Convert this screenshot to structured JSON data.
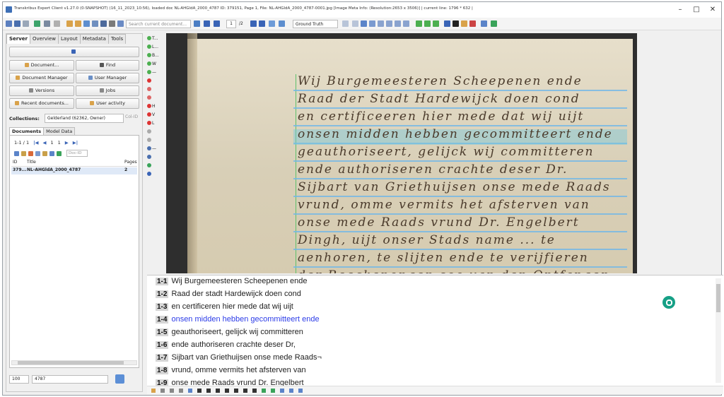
{
  "window": {
    "title": "Transkribus Expert Client v1.27.0 (0-SNAPSHOT) (16_11_2023_10:56), loaded doc NL-AHGldA_2000_4787 ID: 379151, Page 1, File: NL-AHGldA_2000_4787-0001.jpg [Image Meta Info: (Resolution:2653 x 3506)] | current line: 1796 * 632 |",
    "controls": {
      "minimize": "–",
      "maximize": "□",
      "close": "✕"
    }
  },
  "toolbar": {
    "search_placeholder": "Search current document...",
    "page_current": "1",
    "page_total": "/2",
    "view_mode": "Ground Truth"
  },
  "left_panel": {
    "tabs": [
      "Server",
      "Overview",
      "Layout",
      "Metadata",
      "Tools"
    ],
    "buttons": {
      "document": "Document...",
      "find": "Find",
      "document_manager": "Document Manager",
      "user_manager": "User Manager",
      "versions": "Versions",
      "jobs": "Jobs",
      "recent_documents": "Recent documents...",
      "user_activity": "User activity"
    },
    "collections_label": "Collections:",
    "collection_value": "Gelderland (62362, Owner)",
    "collection_id_placeholder": "Col-ID",
    "subtabs": [
      "Documents",
      "Model Data"
    ],
    "nav": {
      "range": "1-1 / 1",
      "page": "1",
      "of": "1"
    },
    "doc_id_placeholder": "Doc-ID",
    "table": {
      "headers": [
        "ID",
        "Title",
        "Pages"
      ],
      "rows": [
        {
          "id": "379...",
          "title": "NL-AHGldA_2000_4787",
          "pages": "2"
        }
      ]
    },
    "page_size": "100",
    "filter_value": "4787"
  },
  "tool_strip": [
    "T...",
    "L...",
    "B...",
    "W",
    "—",
    "",
    "",
    "",
    "H",
    "V",
    "L",
    "",
    "",
    "—",
    "",
    "",
    ""
  ],
  "handwriting": [
    "Wij Burgemeesteren Scheepenen ende",
    "Raad der Stadt Hardewijck doen cond",
    "en certificeeren hier mede dat wij uijt",
    "onsen midden hebben gecommitteert ende",
    "geauthoriseert, gelijck wij committeren",
    "ende authoriseren crachte deser Dr.",
    "Sijbart van Griethuijsen onse mede Raads",
    "vrund, omme vermits het afsterven van",
    "onse mede Raads vrund Dr. Engelbert",
    "Dingh, uijt onser Stads name ... te",
    "aenhoren, te slijten ende te verijfieren",
    "der Reeckenongen soo van den Ontfanger"
  ],
  "transcription": [
    {
      "num": "1-1",
      "text": "Wij Burgemeesteren Scheepenen ende"
    },
    {
      "num": "1-2",
      "text": "Raad der stadt Hardewijck doen cond"
    },
    {
      "num": "1-3",
      "text": "en certificeren hier mede dat wij uijt"
    },
    {
      "num": "1-4",
      "text": "onsen midden hebben gecommitteert ende",
      "active": true
    },
    {
      "num": "1-5",
      "text": "geauthoriseert, gelijck wij committeren"
    },
    {
      "num": "1-6",
      "text": "ende authoriseren crachte deser Dr,"
    },
    {
      "num": "1-7",
      "text": "Sijbart van Griethuijsen onse mede Raads¬"
    },
    {
      "num": "1-8",
      "text": "vrund, omme vermits het afsterven van"
    },
    {
      "num": "1-9",
      "text": "onse mede Raads vrund Dr. Engelbert"
    }
  ],
  "colors": {
    "accent": "#3a64b6",
    "active_line": "#2c3ce8",
    "baseline": "#6fb6e8",
    "highlight": "#78c8dc"
  }
}
